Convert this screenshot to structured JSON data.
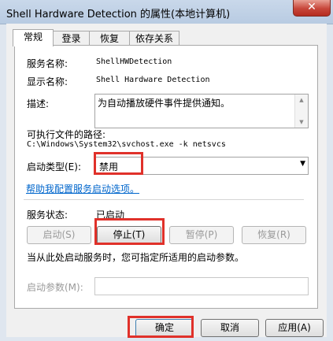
{
  "window": {
    "title": "Shell Hardware Detection 的属性(本地计算机)",
    "close": "✕"
  },
  "tabs": [
    "常规",
    "登录",
    "恢复",
    "依存关系"
  ],
  "general": {
    "service_name_label": "服务名称:",
    "service_name": "ShellHWDetection",
    "display_name_label": "显示名称:",
    "display_name": "Shell Hardware Detection",
    "description_label": "描述:",
    "description": "为自动播放硬件事件提供通知。",
    "path_label": "可执行文件的路径:",
    "path": "C:\\Windows\\System32\\svchost.exe -k netsvcs",
    "startup_type_label": "启动类型(E):",
    "startup_type": "禁用",
    "help_link": "帮助我配置服务启动选项。",
    "status_label": "服务状态:",
    "status": "已启动",
    "start_hint": "当从此处启动服务时，您可指定所适用的启动参数。",
    "start_params_label": "启动参数(M):",
    "start_params_value": ""
  },
  "service_buttons": {
    "start": "启动(S)",
    "stop": "停止(T)",
    "pause": "暂停(P)",
    "resume": "恢复(R)"
  },
  "dialog_buttons": {
    "ok": "确定",
    "cancel": "取消",
    "apply": "应用(A)"
  },
  "highlight_color": "#e0312a"
}
